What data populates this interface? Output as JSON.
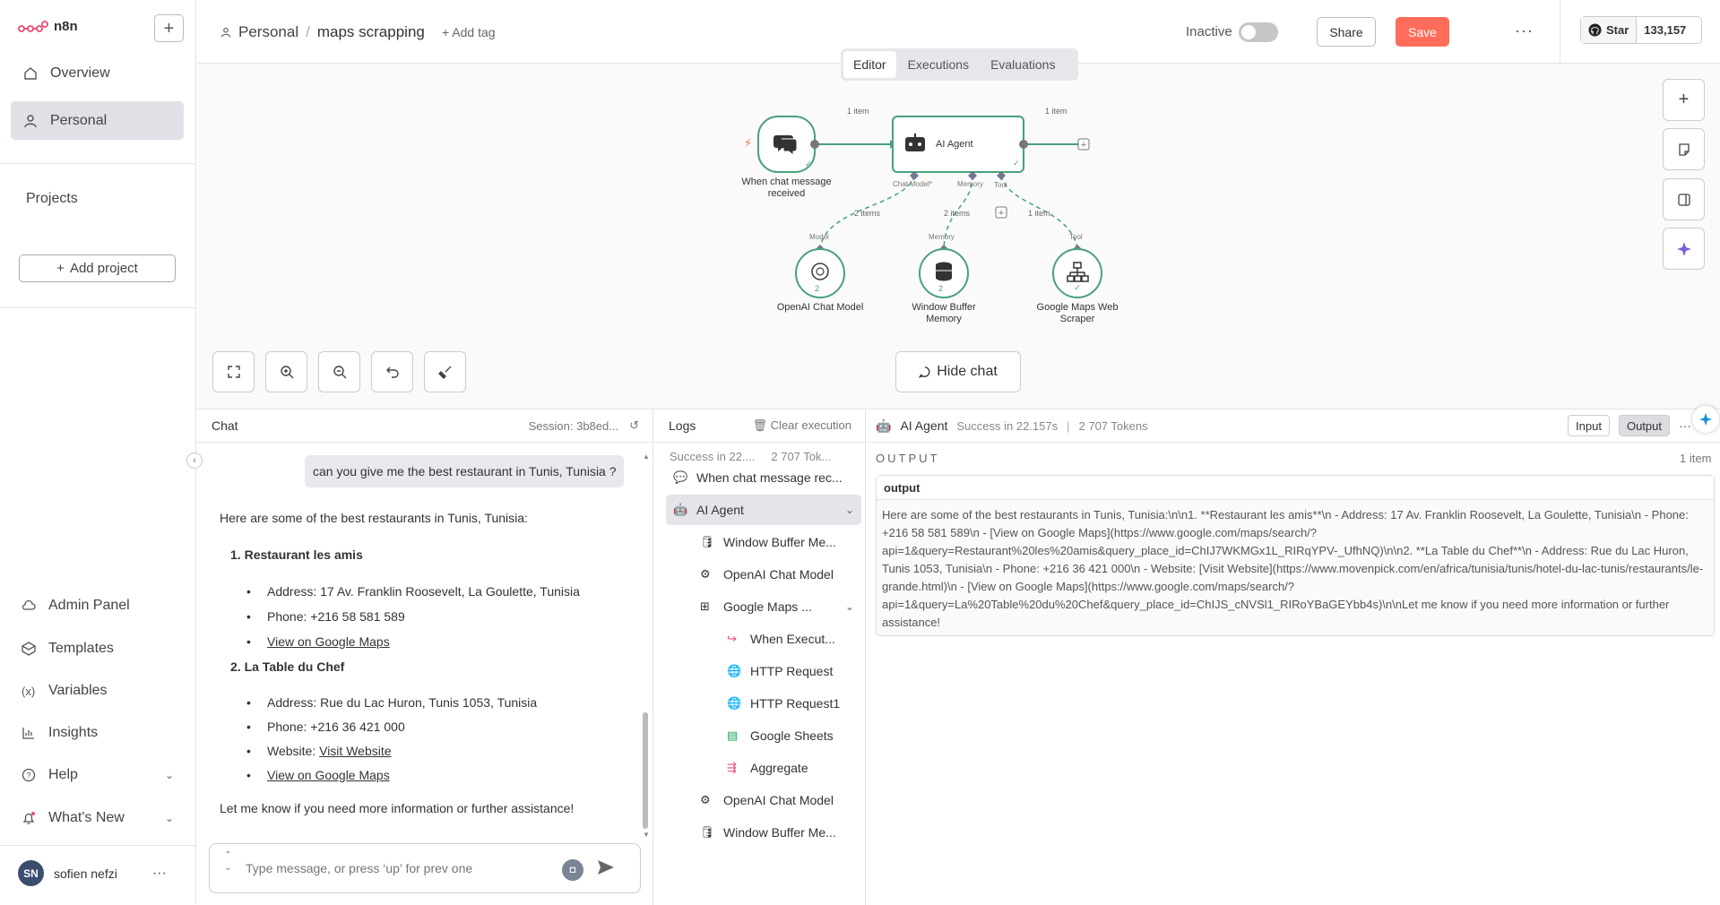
{
  "app": {
    "name": "n8n"
  },
  "sidebar": {
    "items": [
      {
        "label": "Overview",
        "icon": "home-icon"
      },
      {
        "label": "Personal",
        "icon": "user-icon",
        "active": true
      }
    ],
    "projects_label": "Projects",
    "add_project": "Add project",
    "bottom_items": [
      {
        "label": "Admin Panel",
        "icon": "cloud-icon"
      },
      {
        "label": "Templates",
        "icon": "box-icon"
      },
      {
        "label": "Variables",
        "icon": "variables-icon"
      },
      {
        "label": "Insights",
        "icon": "bar-chart-icon"
      },
      {
        "label": "Help",
        "icon": "help-icon"
      },
      {
        "label": "What's New",
        "icon": "bell-icon"
      }
    ],
    "user": {
      "initials": "SN",
      "name": "sofien nefzi"
    }
  },
  "header": {
    "breadcrumb": {
      "project": "Personal",
      "workflow": "maps scrapping"
    },
    "add_tag": "+ Add tag",
    "status": "Inactive",
    "share": "Share",
    "save": "Save",
    "github": {
      "star": "Star",
      "count": "133,157"
    },
    "tabs": [
      "Editor",
      "Executions",
      "Evaluations"
    ]
  },
  "canvas": {
    "nodes": {
      "trigger": "When chat message received",
      "agent": "AI Agent",
      "model": "OpenAI Chat Model",
      "memory": "Window Buffer Memory",
      "tool": "Google Maps Web Scraper"
    },
    "connections": {
      "trigger_agent": "1 item",
      "agent_out": "1 item",
      "model": "2 items",
      "memory": "2 items",
      "tool": "1 item"
    },
    "ports": {
      "chat_model": "Chat Model*",
      "memory": "Memory",
      "tool": "Tool",
      "model": "Model",
      "memory_in": "Memory",
      "tool_in": "Tool"
    },
    "badges": {
      "model": "2",
      "memory": "2"
    },
    "hide_chat": "Hide chat"
  },
  "chat": {
    "title": "Chat",
    "session": "Session: 3b8ed...",
    "user_message": "can you give me the best restaurant in Tunis, Tunisia ?",
    "intro": "Here are some of the best restaurants in Tunis, Tunisia:",
    "restaurants": [
      {
        "num": "1.",
        "name": "Restaurant les amis",
        "address": "Address: 17 Av. Franklin Roosevelt, La Goulette, Tunisia",
        "phone": "Phone: +216 58 581 589",
        "maps": "View on Google Maps"
      },
      {
        "num": "2.",
        "name": "La Table du Chef",
        "address": "Address: Rue du Lac Huron, Tunis 1053, Tunisia",
        "phone": "Phone: +216 36 421 000",
        "website_label": "Website:",
        "website": "Visit Website",
        "maps": "View on Google Maps"
      }
    ],
    "closing": "Let me know if you need more information or further assistance!",
    "input_placeholder": "Type message, or press ‘up’ for prev one"
  },
  "logs": {
    "title": "Logs",
    "clear": "Clear execution",
    "summary": "Success in 22....",
    "tokens": "2 707 Tok...",
    "rows": [
      {
        "label": "When chat message rec...",
        "icon": "chat-icon",
        "indent": 0
      },
      {
        "label": "AI Agent",
        "icon": "robot-icon",
        "indent": 0,
        "selected": true
      },
      {
        "label": "Window Buffer Me...",
        "icon": "database-icon",
        "indent": 1
      },
      {
        "label": "OpenAI Chat Model",
        "icon": "openai-icon",
        "indent": 1
      },
      {
        "label": "Google Maps ...",
        "icon": "sitemap-icon",
        "indent": 1
      },
      {
        "label": "When Execut...",
        "icon": "exec-trigger-icon",
        "indent": 2
      },
      {
        "label": "HTTP Request",
        "icon": "globe-icon",
        "indent": 2
      },
      {
        "label": "HTTP Request1",
        "icon": "globe-icon",
        "indent": 2
      },
      {
        "label": "Google Sheets",
        "icon": "sheets-icon",
        "indent": 2
      },
      {
        "label": "Aggregate",
        "icon": "aggregate-icon",
        "indent": 2
      },
      {
        "label": "OpenAI Chat Model",
        "icon": "openai-icon",
        "indent": 1
      },
      {
        "label": "Window Buffer Me...",
        "icon": "database-icon",
        "indent": 1
      }
    ]
  },
  "output": {
    "node": "AI Agent",
    "status": "Success in 22.157s",
    "tokens": "2 707 Tokens",
    "input_btn": "Input",
    "output_btn": "Output",
    "section": "OUTPUT",
    "count": "1 item",
    "field": "output",
    "text": "Here are some of the best restaurants in Tunis, Tunisia:\\n\\n1. **Restaurant les amis**\\n   - Address: 17 Av. Franklin Roosevelt, La Goulette, Tunisia\\n   - Phone: +216 58 581 589\\n   - [View on Google Maps](https://www.google.com/maps/search/?api=1&query=Restaurant%20les%20amis&query_place_id=ChIJ7WKMGx1L_RIRqYPV-_UfhNQ)\\n\\n2. **La Table du Chef**\\n   - Address: Rue du Lac Huron, Tunis 1053, Tunisia\\n   - Phone: +216 36 421 000\\n   - Website: [Visit Website](https://www.movenpick.com/en/africa/tunisia/tunis/hotel-du-lac-tunis/restaurants/le-grande.html)\\n   - [View on Google Maps](https://www.google.com/maps/search/?api=1&query=La%20Table%20du%20Chef&query_place_id=ChIJS_cNVSl1_RIRoYBaGEYbb4s)\\n\\nLet me know if you need more information or further assistance!"
  },
  "colors": {
    "accent": "#ff6d5a",
    "success": "#2d9e6b",
    "node_border": "#49a07b"
  }
}
